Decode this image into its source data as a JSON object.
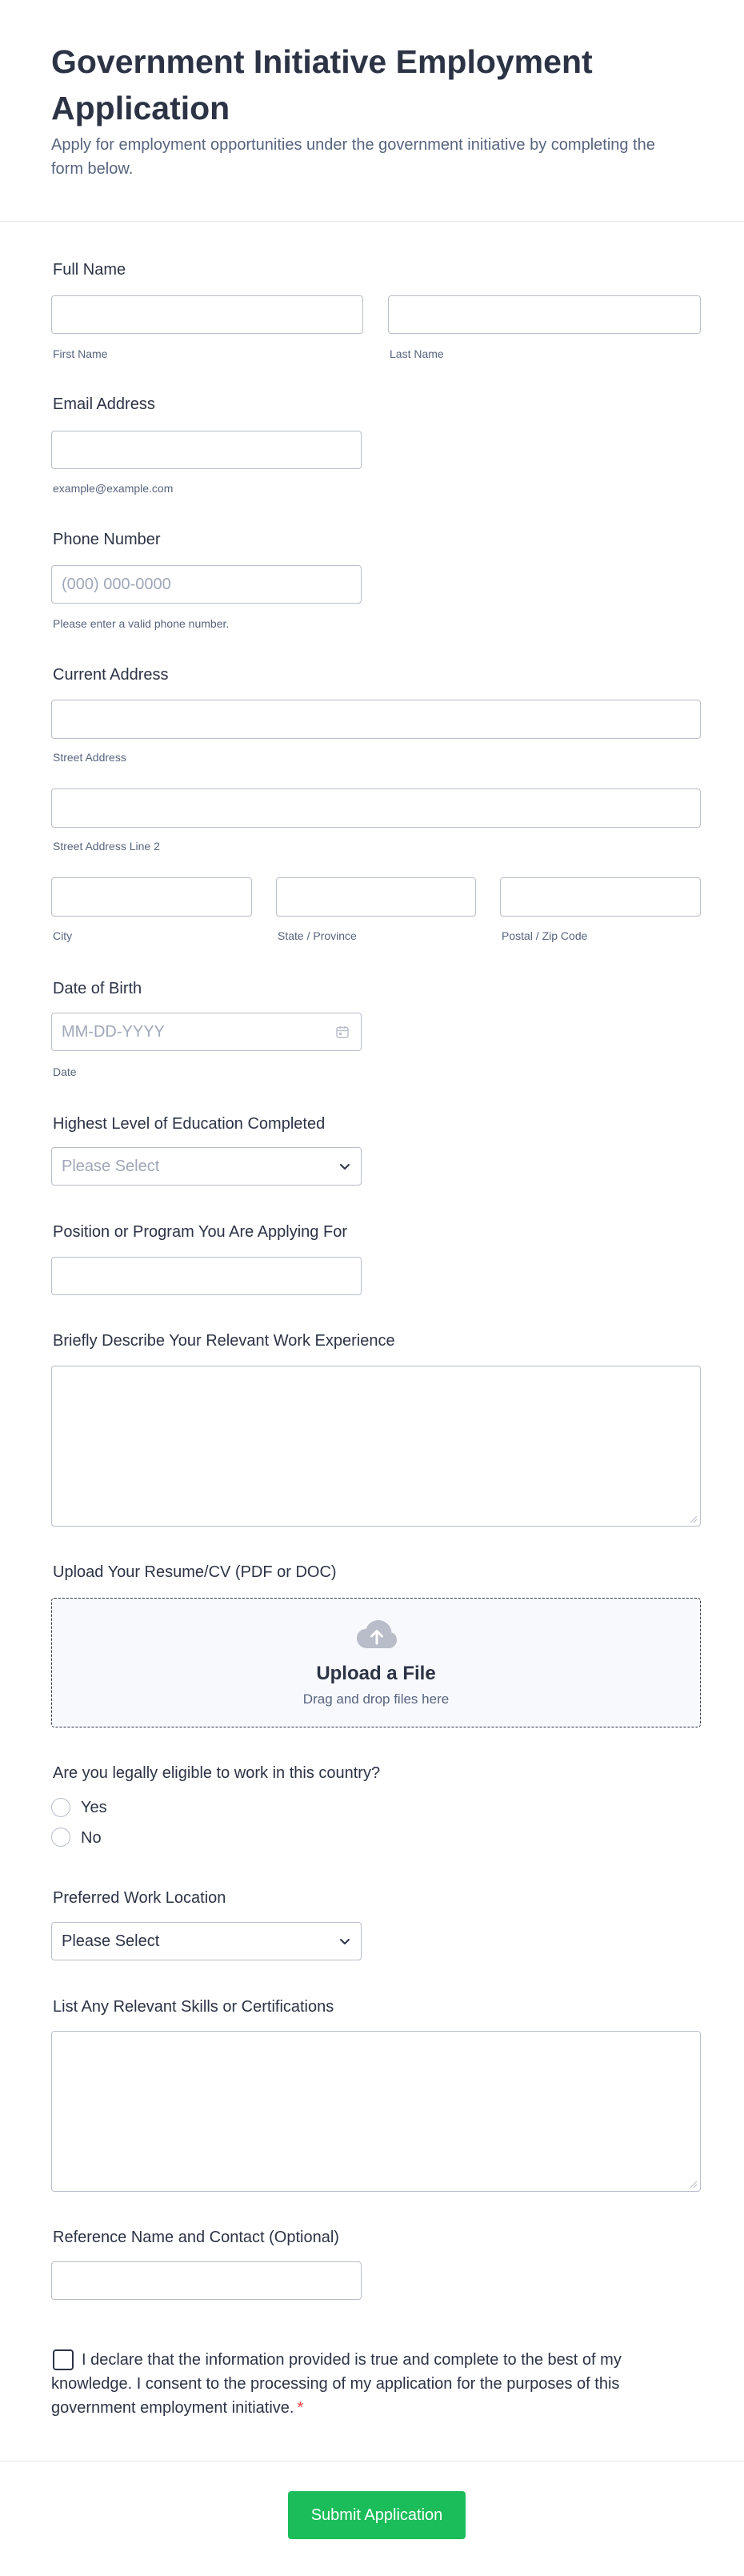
{
  "header": {
    "title": "Government Initiative Employment Application",
    "subtitle": "Apply for employment opportunities under the government initiative by completing the form below."
  },
  "full_name": {
    "label": "Full Name",
    "first_sub": "First Name",
    "last_sub": "Last Name"
  },
  "email": {
    "label": "Email Address",
    "sub": "example@example.com"
  },
  "phone": {
    "label": "Phone Number",
    "placeholder": "(000) 000-0000",
    "sub": "Please enter a valid phone number."
  },
  "address": {
    "label": "Current Address",
    "street_sub": "Street Address",
    "street2_sub": "Street Address Line 2",
    "city_sub": "City",
    "state_sub": "State / Province",
    "postal_sub": "Postal / Zip Code"
  },
  "dob": {
    "label": "Date of Birth",
    "placeholder": "MM-DD-YYYY",
    "sub": "Date",
    "icon": "calendar-icon"
  },
  "education": {
    "label": "Highest Level of Education Completed",
    "selected": "Please Select"
  },
  "position": {
    "label": "Position or Program You Are Applying For"
  },
  "experience": {
    "label": "Briefly Describe Your Relevant Work Experience"
  },
  "resume": {
    "label": "Upload Your Resume/CV (PDF or DOC)",
    "title": "Upload a File",
    "hint": "Drag and drop files here",
    "icon": "cloud-upload-icon"
  },
  "eligibility": {
    "label": "Are you legally eligible to work in this country?",
    "options": [
      "Yes",
      "No"
    ]
  },
  "location": {
    "label": "Preferred Work Location",
    "selected": "Please Select"
  },
  "skills": {
    "label": "List Any Relevant Skills or Certifications"
  },
  "reference": {
    "label": "Reference Name and Contact (Optional)"
  },
  "declaration": {
    "text": "I declare that the information provided is true and complete to the best of my knowledge. I consent to the processing of my application for the purposes of this government employment initiative.",
    "required_mark": "*"
  },
  "submit": {
    "label": "Submit Application"
  },
  "colors": {
    "accent": "#1bbd5a",
    "text": "#2c3345",
    "muted": "#57647e",
    "border": "#b8bdc9",
    "required": "#f23a3c"
  }
}
